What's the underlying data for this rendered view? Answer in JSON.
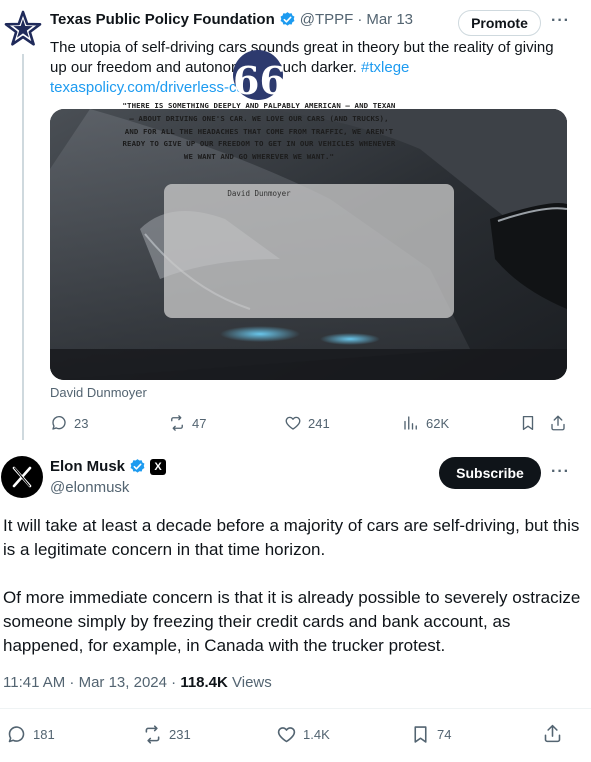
{
  "quoted_tweet": {
    "author_name": "Texas Public Policy Foundation",
    "handle": "@TPPF",
    "date": "Mar 13",
    "promote_label": "Promote",
    "more_label": "···",
    "text": "The utopia of self-driving cars sounds great in theory but the reality of giving up our freedom and autonomy is much darker.",
    "hashtag": "#txlege",
    "link": "texaspolicy.com/driverless-car…",
    "media": {
      "quote_text": "\"THERE IS SOMETHING DEEPLY AND PALPABLY AMERICAN – AND TEXAN – ABOUT DRIVING ONE'S CAR. WE LOVE OUR CARS (AND TRUCKS), AND FOR ALL THE HEADACHES THAT COME FROM TRAFFIC, WE AREN'T READY TO GIVE UP OUR FREEDOM TO GET IN OUR VEHICLES WHENEVER WE WANT AND GO WHEREVER WE WANT.\"",
      "quote_author": "David Dunmoyer",
      "quote_mark": "66"
    },
    "media_caption": "David Dunmoyer",
    "stats": {
      "replies": "23",
      "reposts": "47",
      "likes": "241",
      "views": "62K"
    }
  },
  "main_tweet": {
    "author_name": "Elon Musk",
    "handle": "@elonmusk",
    "subscribe_label": "Subscribe",
    "more_label": "···",
    "x_badge": "X",
    "paragraphs": [
      "It will take at least a decade before a majority of cars are self-driving, but this is a legitimate concern in that time horizon.",
      "Of more immediate concern is that it is already possible to severely ostracize someone simply by freezing their credit cards and bank account, as happened, for example, in Canada with the trucker protest."
    ],
    "timestamp": "11:41 AM · Mar 13, 2024 · ",
    "views_count": "118.4K",
    "views_label": " Views",
    "stats": {
      "replies": "181",
      "reposts": "231",
      "likes": "1.4K",
      "bookmarks": "74"
    }
  },
  "colors": {
    "accent": "#1d9bf0",
    "text": "#0f1419",
    "muted": "#536471",
    "tppf_navy": "#1f2a5a"
  }
}
